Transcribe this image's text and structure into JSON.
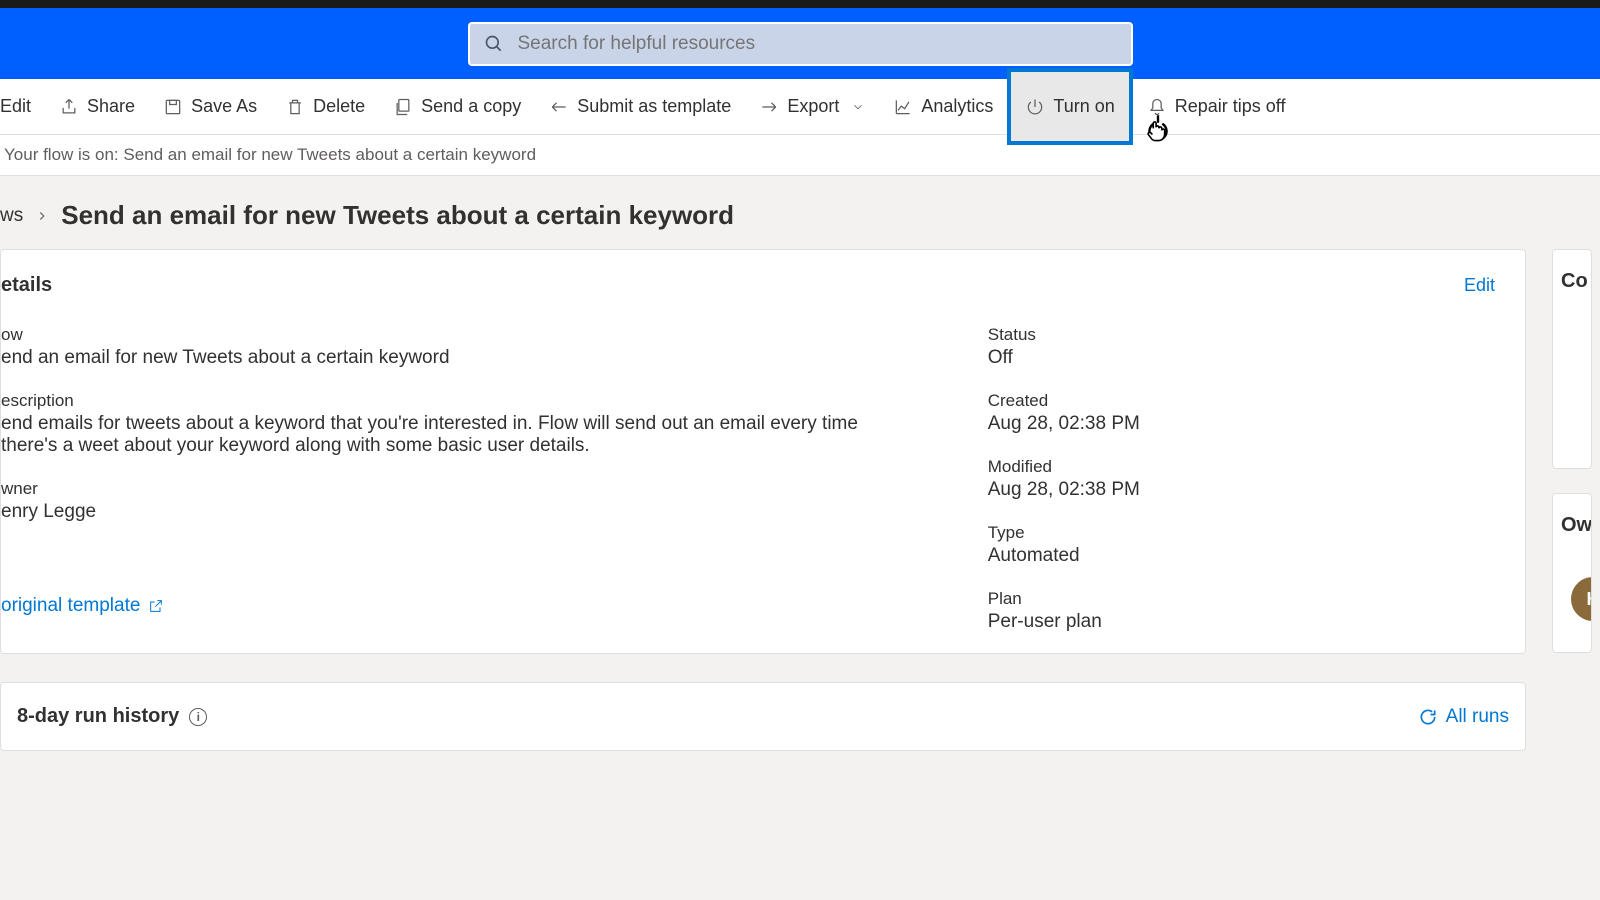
{
  "search": {
    "placeholder": "Search for helpful resources"
  },
  "toolbar": {
    "edit": "Edit",
    "share": "Share",
    "save_as": "Save As",
    "delete": "Delete",
    "send_copy": "Send a copy",
    "submit_template": "Submit as template",
    "export": "Export",
    "analytics": "Analytics",
    "turn_on": "Turn on",
    "repair_tips": "Repair tips off"
  },
  "status_message": "Your flow is on: Send an email for new Tweets about a certain keyword",
  "breadcrumb": {
    "parent": "ws",
    "current": "Send an email for new Tweets about a certain keyword"
  },
  "details": {
    "section_title": "etails",
    "edit_label": "Edit",
    "flow_label": "ow",
    "flow_value": "end an email for new Tweets about a certain keyword",
    "description_label": "escription",
    "description_value": "end emails for tweets about a keyword that you're interested in. Flow will send out an email every time there's a weet about your keyword along with some basic user details.",
    "owner_label": "wner",
    "owner_value": "enry Legge",
    "status_label": "Status",
    "status_value": "Off",
    "created_label": "Created",
    "created_value": "Aug 28, 02:38 PM",
    "modified_label": "Modified",
    "modified_value": "Aug 28, 02:38 PM",
    "type_label": "Type",
    "type_value": "Automated",
    "plan_label": "Plan",
    "plan_value": "Per-user plan",
    "template_link": "original template"
  },
  "side": {
    "connections_title": "Co",
    "owners_title": "Ow",
    "avatar_initial": "H"
  },
  "history": {
    "title": "8-day run history",
    "all_runs": "All runs"
  }
}
